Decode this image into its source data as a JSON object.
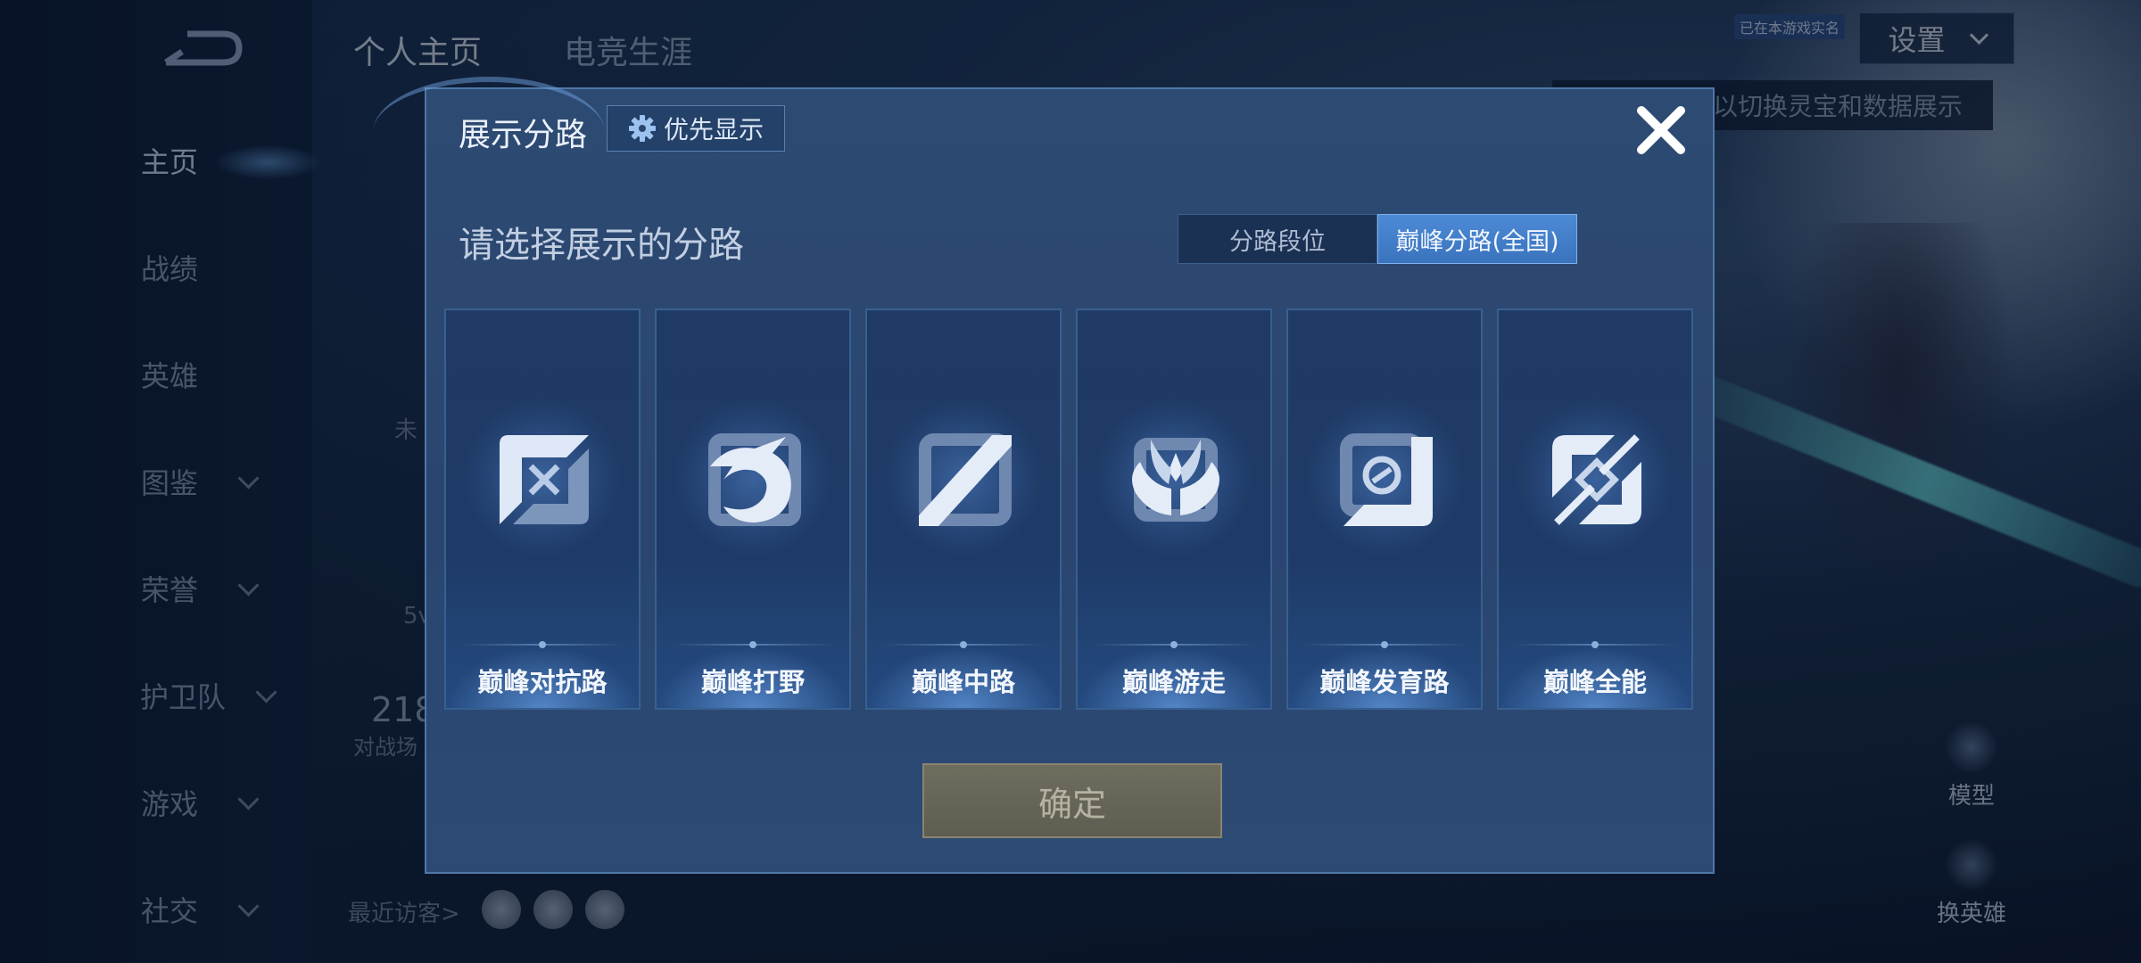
{
  "background": {
    "tabs": [
      "个人主页",
      "电竞生涯"
    ],
    "sidebar": [
      {
        "label": "主页",
        "active": true,
        "has_chevron": false
      },
      {
        "label": "战绩",
        "active": false,
        "has_chevron": false
      },
      {
        "label": "英雄",
        "active": false,
        "has_chevron": false
      },
      {
        "label": "图鉴",
        "active": false,
        "has_chevron": true
      },
      {
        "label": "荣誉",
        "active": false,
        "has_chevron": true
      },
      {
        "label": "护卫队",
        "active": false,
        "has_chevron": true
      },
      {
        "label": "游戏",
        "active": false,
        "has_chevron": true
      },
      {
        "label": "社交",
        "active": false,
        "has_chevron": true
      }
    ],
    "settings_label": "设置",
    "tag_text": "已在本游戏实名",
    "hint_text": "以切换灵宝和数据展示",
    "partial_text_1": "未",
    "partial_text_2": "5v",
    "partial_stat": "218",
    "partial_stat_label": "对战场",
    "recent_visitors_label": "最近访客>",
    "model_label": "模型",
    "change_hero_label": "换英雄"
  },
  "modal": {
    "title": "展示分路",
    "priority_label": "优先显示",
    "subtitle": "请选择展示的分路",
    "toggle": {
      "option_rank": "分路段位",
      "option_peak": "巅峰分路(全国)",
      "selected": "option_peak"
    },
    "cards": [
      {
        "label": "巅峰对抗路",
        "icon": "clash-lane-icon"
      },
      {
        "label": "巅峰打野",
        "icon": "jungle-dragon-icon"
      },
      {
        "label": "巅峰中路",
        "icon": "mid-lane-icon"
      },
      {
        "label": "巅峰游走",
        "icon": "roam-wings-icon"
      },
      {
        "label": "巅峰发育路",
        "icon": "farm-lane-icon"
      },
      {
        "label": "巅峰全能",
        "icon": "all-round-icon"
      }
    ],
    "confirm_label": "确定",
    "close_icon": "close-icon"
  },
  "colors": {
    "accent_blue": "#4d8ad6",
    "card_border": "#38608f",
    "confirm_disabled": "#6e6d5e"
  }
}
